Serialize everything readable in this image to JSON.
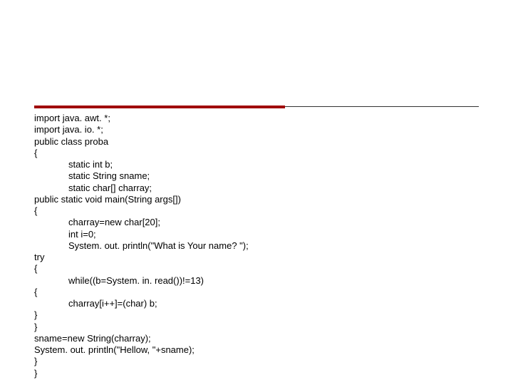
{
  "code": {
    "lines": [
      {
        "text": "import java. awt. *;",
        "indent": 0
      },
      {
        "text": "import java. io. *;",
        "indent": 0
      },
      {
        "text": "public class proba",
        "indent": 0
      },
      {
        "text": "{",
        "indent": 0
      },
      {
        "text": "static int b;",
        "indent": 1
      },
      {
        "text": "static String sname;",
        "indent": 1
      },
      {
        "text": "static char[] charray;",
        "indent": 1
      },
      {
        "text": "public static void main(String args[])",
        "indent": 0
      },
      {
        "text": "{",
        "indent": 0
      },
      {
        "text": "charray=new char[20];",
        "indent": 1
      },
      {
        "text": "int i=0;",
        "indent": 1
      },
      {
        "text": "System. out. println(\"What is Your name? \");",
        "indent": 1
      },
      {
        "text": "try",
        "indent": 0
      },
      {
        "text": "{",
        "indent": 0
      },
      {
        "text": "while((b=System. in. read())!=13)",
        "indent": 1
      },
      {
        "text": "{",
        "indent": 0
      },
      {
        "text": "charray[i++]=(char) b;",
        "indent": 1
      },
      {
        "text": "}",
        "indent": 0
      },
      {
        "text": "}",
        "indent": 0
      },
      {
        "text": "sname=new String(charray);",
        "indent": 0
      },
      {
        "text": "System. out. println(\"Hellow, \"+sname);",
        "indent": 0
      },
      {
        "text": "}",
        "indent": 0
      },
      {
        "text": "}",
        "indent": 0
      }
    ]
  }
}
